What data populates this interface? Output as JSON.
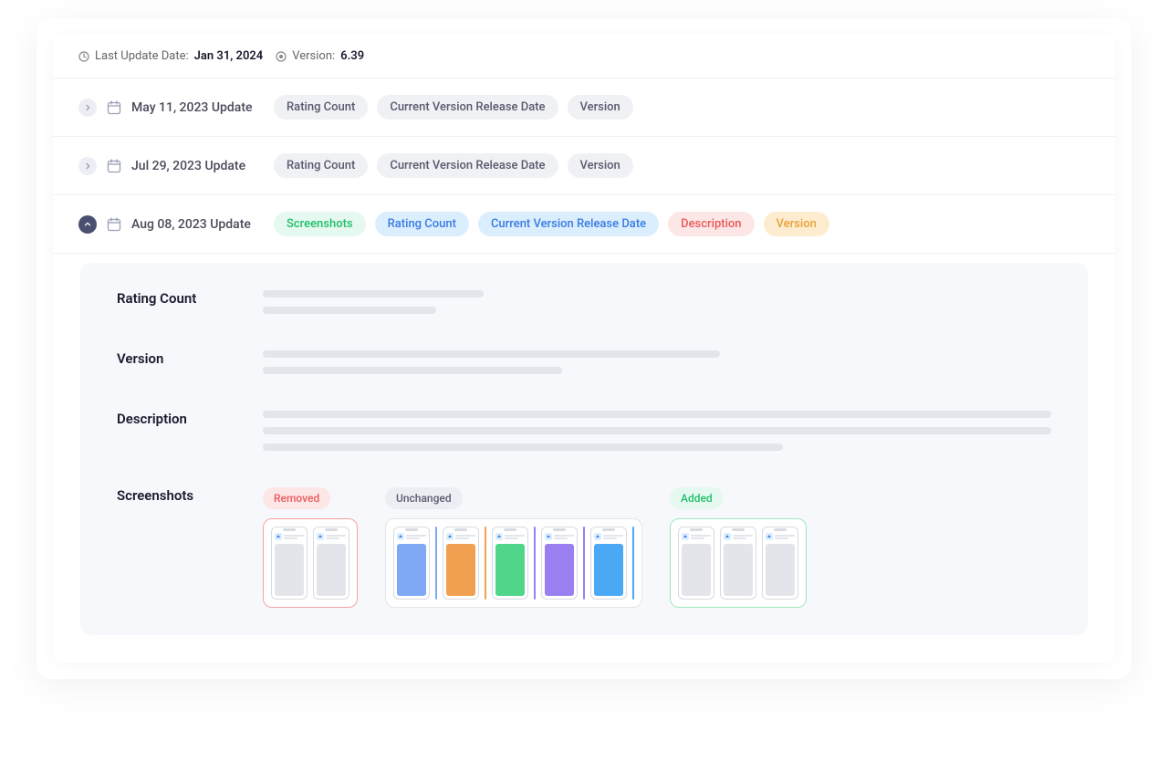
{
  "header": {
    "last_update_label": "Last Update Date:",
    "last_update_value": "Jan 31, 2024",
    "version_label": "Version:",
    "version_value": "6.39"
  },
  "updates": [
    {
      "title": "May 11, 2023 Update",
      "expanded": false,
      "tags": [
        {
          "text": "Rating Count",
          "style": "gray"
        },
        {
          "text": "Current Version Release Date",
          "style": "gray"
        },
        {
          "text": "Version",
          "style": "gray"
        }
      ]
    },
    {
      "title": "Jul 29, 2023 Update",
      "expanded": false,
      "tags": [
        {
          "text": "Rating Count",
          "style": "gray"
        },
        {
          "text": "Current Version Release Date",
          "style": "gray"
        },
        {
          "text": "Version",
          "style": "gray"
        }
      ]
    },
    {
      "title": "Aug 08, 2023 Update",
      "expanded": true,
      "tags": [
        {
          "text": "Screenshots",
          "style": "green"
        },
        {
          "text": "Rating Count",
          "style": "blue"
        },
        {
          "text": "Current Version Release Date",
          "style": "blue"
        },
        {
          "text": "Description",
          "style": "red"
        },
        {
          "text": "Version",
          "style": "orange"
        }
      ]
    }
  ],
  "detail": {
    "sections": {
      "rating_count": "Rating Count",
      "version": "Version",
      "description": "Description",
      "screenshots": "Screenshots"
    },
    "screenshot_groups": [
      {
        "label": "Removed",
        "style": "removed",
        "phones": [
          {
            "color": "#e3e5eb"
          },
          {
            "color": "#e3e5eb"
          }
        ]
      },
      {
        "label": "Unchanged",
        "style": "unchanged",
        "phones": [
          {
            "color": "#7fa8f5",
            "accent": "#7fa8f5"
          },
          {
            "color": "#f0a050",
            "accent": "#f0a050"
          },
          {
            "color": "#4fd68a",
            "accent": "#9a7ff0"
          },
          {
            "color": "#9a7ff0",
            "accent": "#9a7ff0"
          },
          {
            "color": "#4aa8f5",
            "accent": "#4aa8f5"
          }
        ]
      },
      {
        "label": "Added",
        "style": "added",
        "phones": [
          {
            "color": "#e3e5eb"
          },
          {
            "color": "#e3e5eb"
          },
          {
            "color": "#e3e5eb"
          }
        ]
      }
    ]
  }
}
